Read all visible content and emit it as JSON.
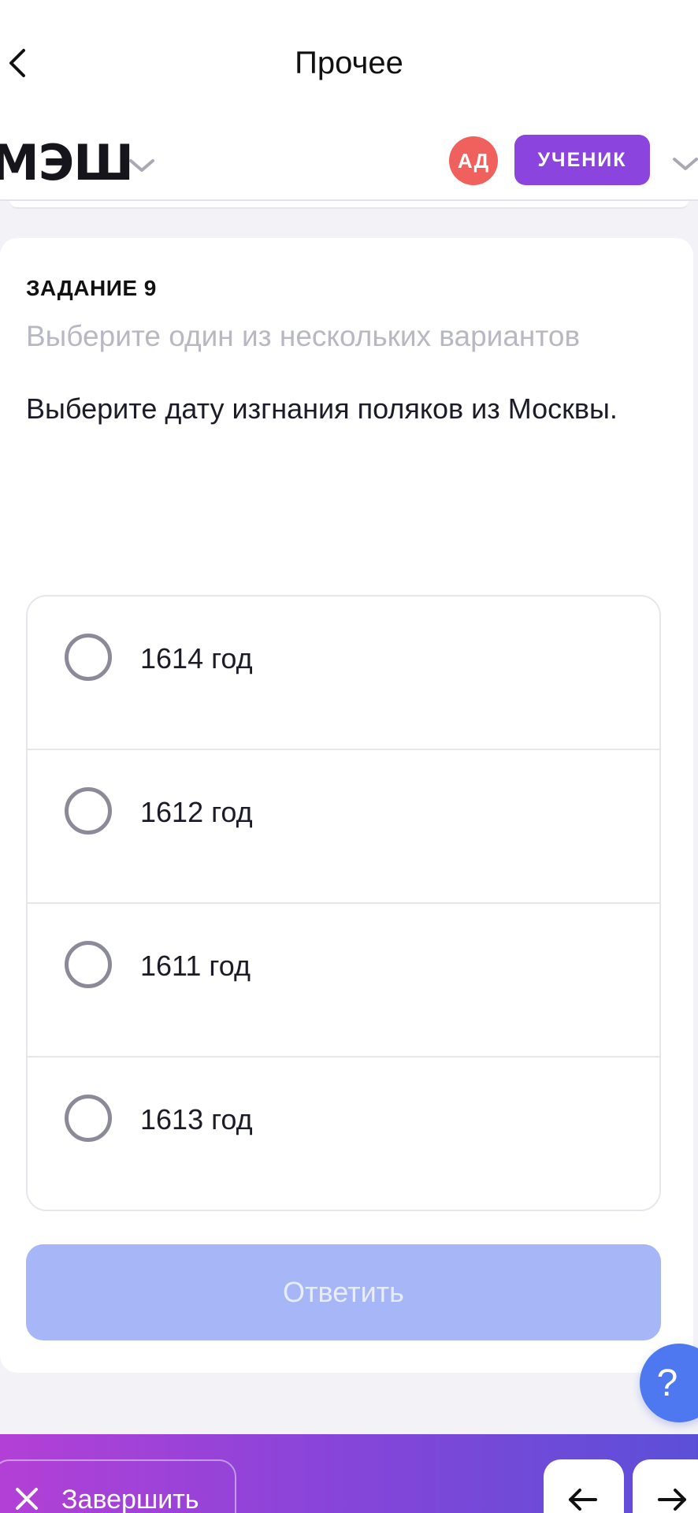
{
  "nav": {
    "title": "Прочее",
    "back_icon": "chevron-left-icon"
  },
  "header": {
    "logo": "МЭШ",
    "avatar_initials": "АД",
    "role": "УЧЕНИК",
    "colors": {
      "avatar": "#f0605d",
      "role_badge": "#8b44dd"
    }
  },
  "task": {
    "number": "ЗАДАНИЕ 9",
    "instruction": "Выберите один из нескольких вариантов",
    "question": "Выберите дату изгнания поляков из Москвы.",
    "options": [
      {
        "label": "1614 год",
        "selected": false
      },
      {
        "label": "1612 год",
        "selected": false
      },
      {
        "label": "1611 год",
        "selected": false
      },
      {
        "label": "1613 год",
        "selected": false
      }
    ],
    "submit_label": "Ответить",
    "submit_enabled": false
  },
  "help": {
    "label": "?"
  },
  "bottom": {
    "finish_label": "Завершить",
    "prev_icon": "arrow-left-icon",
    "next_icon": "arrow-right-icon"
  }
}
